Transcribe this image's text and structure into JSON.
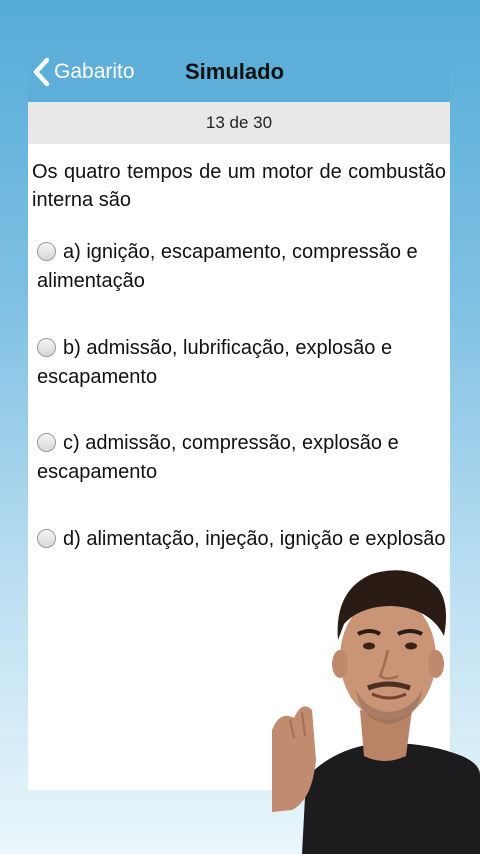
{
  "navbar": {
    "back_label": "Gabarito",
    "title": "Simulado"
  },
  "progress": {
    "label": "13 de 30"
  },
  "question": {
    "text": "Os quatro tempos de um motor de combustão interna são"
  },
  "options": [
    {
      "text": "a) ignição, escapamento, compressão e alimentação"
    },
    {
      "text": "b) admissão, lubrificação, explosão e escapamento"
    },
    {
      "text": "c) admissão, compressão, explosão e escapamento"
    },
    {
      "text": "d) alimentação, injeção, ignição e explosão"
    }
  ],
  "colors": {
    "navbar": "#5dafd9",
    "counter_bar": "#e8e8e8",
    "background_top": "#55acd8",
    "background_bottom": "#eaf6fb"
  }
}
